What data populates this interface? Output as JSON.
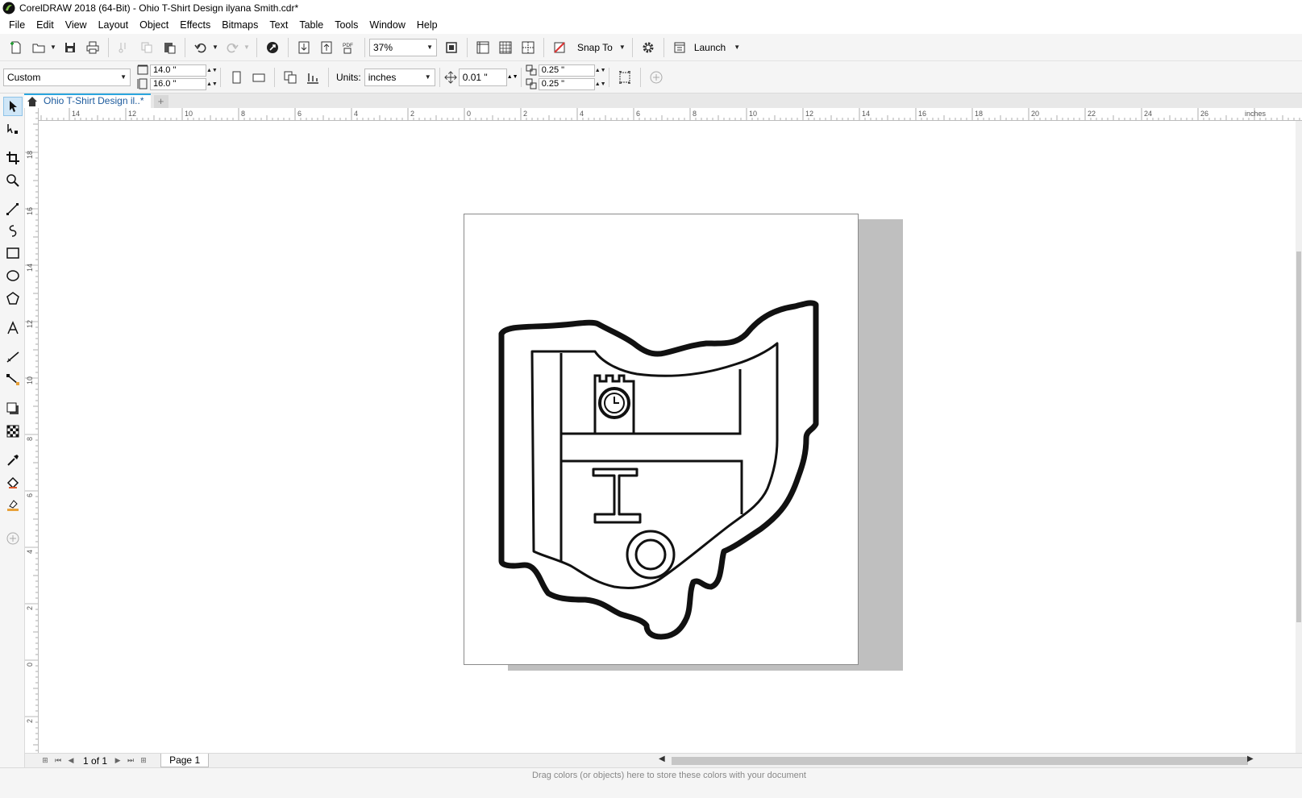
{
  "window": {
    "title": "CorelDRAW 2018 (64-Bit) - Ohio T-Shirt Design ilyana Smith.cdr*"
  },
  "menu": [
    "File",
    "Edit",
    "View",
    "Layout",
    "Object",
    "Effects",
    "Bitmaps",
    "Text",
    "Table",
    "Tools",
    "Window",
    "Help"
  ],
  "toolbar": {
    "zoom": "37%",
    "snap_label": "Snap To",
    "launch_label": "Launch",
    "pdf_label": "PDF"
  },
  "property_bar": {
    "page_preset": "Custom",
    "width": "14.0 \"",
    "height": "16.0 \"",
    "units_label": "Units:",
    "units_value": "inches",
    "nudge": "0.01 \"",
    "dup_x": "0.25 \"",
    "dup_y": "0.25 \""
  },
  "document_tab": {
    "label": "Ohio T-Shirt Design il..*"
  },
  "rulers": {
    "units": "inches",
    "h_labels": [
      "14",
      "12",
      "10",
      "8",
      "6",
      "4",
      "2",
      "0",
      "2",
      "4",
      "6",
      "8",
      "10",
      "12",
      "14",
      "16",
      "18",
      "20",
      "22",
      "24",
      "26"
    ],
    "v_labels": [
      "18",
      "16",
      "14",
      "12",
      "10",
      "8",
      "6",
      "4",
      "2",
      "0",
      "2"
    ]
  },
  "page_nav": {
    "current": "1",
    "of_label": "of",
    "total": "1",
    "page_tab": "Page 1"
  },
  "status": {
    "hint": "Drag colors (or objects) here to store these colors with your document"
  },
  "colors": {
    "accent": "#2ba6de",
    "selected_tool_bg": "#cfe6f7",
    "canvas": "#ffffff",
    "chrome": "#f5f5f5"
  }
}
